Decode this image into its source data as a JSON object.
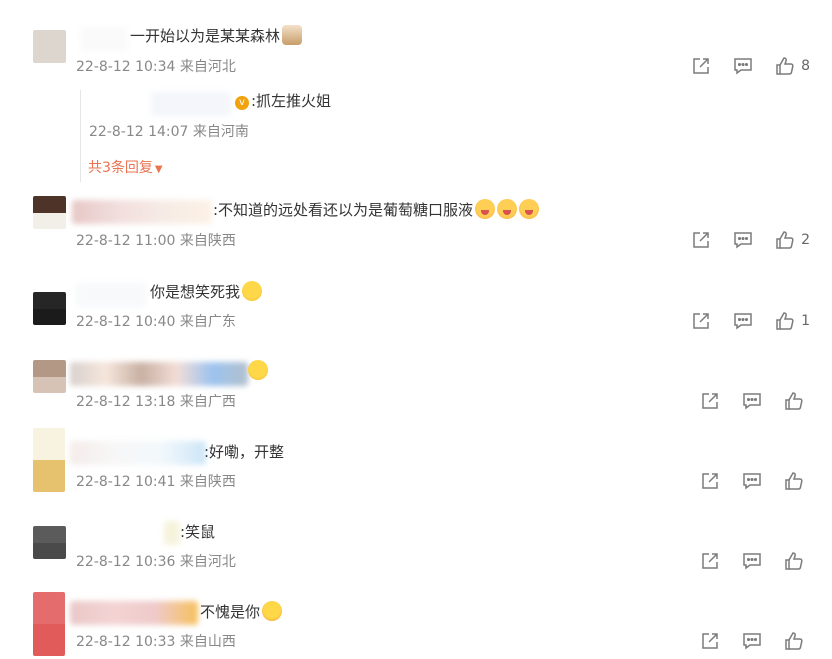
{
  "comments": [
    {
      "text": "一开始以为是某某森林",
      "emoji": "cat-emoji",
      "meta": "22-8-12 10:34 来自河北",
      "likes": "8",
      "reply": {
        "text": ":抓左推火姐",
        "meta": "22-8-12 14:07 来自河南",
        "more": "共3条回复"
      }
    },
    {
      "text": ":不知道的远处看还以为是葡萄糖口服液",
      "emoji": "cry-emoji",
      "meta": "22-8-12 11:00 来自陕西",
      "likes": "2"
    },
    {
      "text": "你是想笑死我",
      "emoji": "laugh-emoji",
      "meta": "22-8-12 10:40 来自广东",
      "likes": "1"
    },
    {
      "text": "",
      "emoji": "laugh-emoji",
      "meta": "22-8-12 13:18 来自广西",
      "likes": ""
    },
    {
      "text": ":好嘞，开整",
      "meta": "22-8-12 10:41 来自陕西",
      "likes": ""
    },
    {
      "text": ":笑鼠",
      "meta": "22-8-12 10:36 来自河北",
      "likes": ""
    },
    {
      "text": "不愧是你",
      "emoji": "star-eyes-emoji",
      "meta": "22-8-12 10:33 来自山西",
      "likes": ""
    }
  ],
  "icons": {
    "share": "share-icon",
    "comment": "comment-icon",
    "like": "thumbs-up-icon"
  },
  "colors": {
    "accent": "#eb7350",
    "meta": "#888888",
    "icon": "#7b7b7b"
  }
}
